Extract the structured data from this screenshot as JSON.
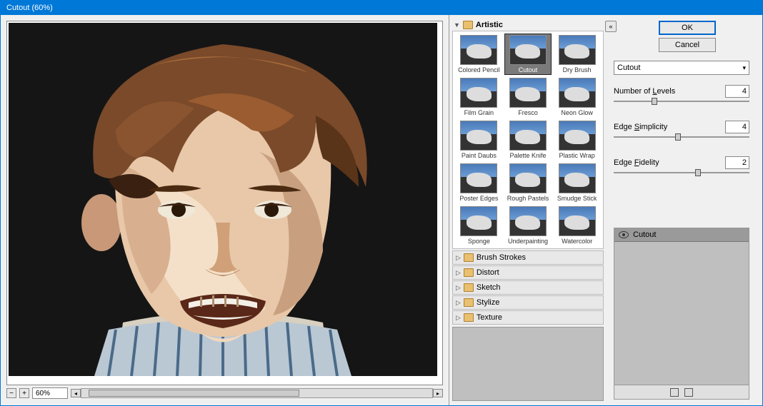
{
  "window": {
    "title": "Cutout (60%)"
  },
  "preview": {
    "zoom": "60%"
  },
  "categories": {
    "expanded": "Artistic",
    "thumbs": [
      {
        "label": "Colored Pencil"
      },
      {
        "label": "Cutout",
        "selected": true
      },
      {
        "label": "Dry Brush"
      },
      {
        "label": "Film Grain"
      },
      {
        "label": "Fresco"
      },
      {
        "label": "Neon Glow"
      },
      {
        "label": "Paint Daubs"
      },
      {
        "label": "Palette Knife"
      },
      {
        "label": "Plastic Wrap"
      },
      {
        "label": "Poster Edges"
      },
      {
        "label": "Rough Pastels"
      },
      {
        "label": "Smudge Stick"
      },
      {
        "label": "Sponge"
      },
      {
        "label": "Underpainting"
      },
      {
        "label": "Watercolor"
      }
    ],
    "collapsed": [
      "Brush Strokes",
      "Distort",
      "Sketch",
      "Stylize",
      "Texture"
    ]
  },
  "buttons": {
    "ok": "OK",
    "cancel": "Cancel"
  },
  "filterSelect": {
    "current": "Cutout"
  },
  "params": [
    {
      "label": "Number of Levels",
      "u": "L",
      "value": "4",
      "pos": 28
    },
    {
      "label": "Edge Simplicity",
      "u": "S",
      "value": "4",
      "pos": 45
    },
    {
      "label": "Edge Fidelity",
      "u": "F",
      "value": "2",
      "pos": 60
    }
  ],
  "layers": {
    "active": "Cutout"
  }
}
